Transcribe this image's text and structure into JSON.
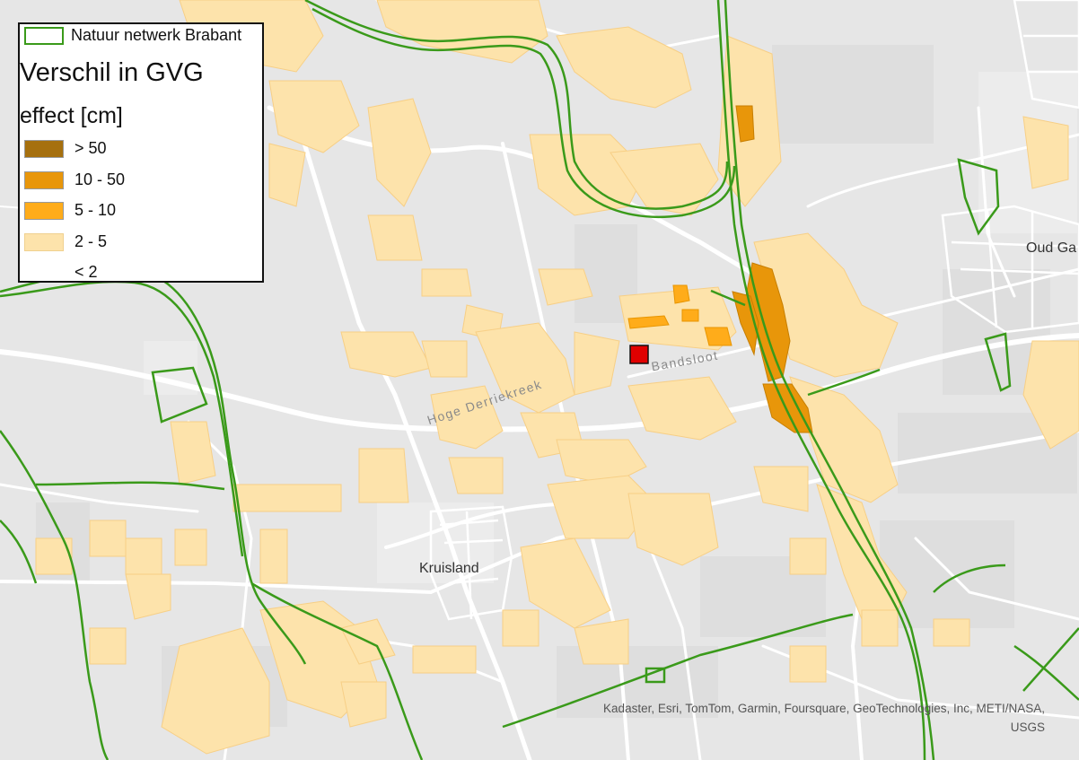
{
  "legend": {
    "network_label": "Natuur netwerk Brabant",
    "title": "Verschil in GVG",
    "subtitle": "effect [cm]",
    "classes": [
      {
        "label": "> 50",
        "color": "#a6700e"
      },
      {
        "label": "10 - 50",
        "color": "#e8960a"
      },
      {
        "label": "5 - 10",
        "color": "#ffac1a"
      },
      {
        "label": "2 - 5",
        "color": "#fde3ab"
      },
      {
        "label": "< 2",
        "color": ""
      }
    ]
  },
  "labels": {
    "bandsloot": "Bandsloot",
    "hoge_derriekreek": "Hoge Derriekreek",
    "kruisland": "Kruisland",
    "oud_gastel": "Oud Ga"
  },
  "attribution": {
    "line1": "Kadaster, Esri, TomTom, Garmin, Foursquare, GeoTechnologies, Inc, METI/NASA,",
    "line2": "USGS"
  },
  "colors": {
    "background": "#e6e6e6",
    "roads": "#ffffff",
    "network_outline": "#3a9a1a",
    "site_marker": "#e00000"
  }
}
